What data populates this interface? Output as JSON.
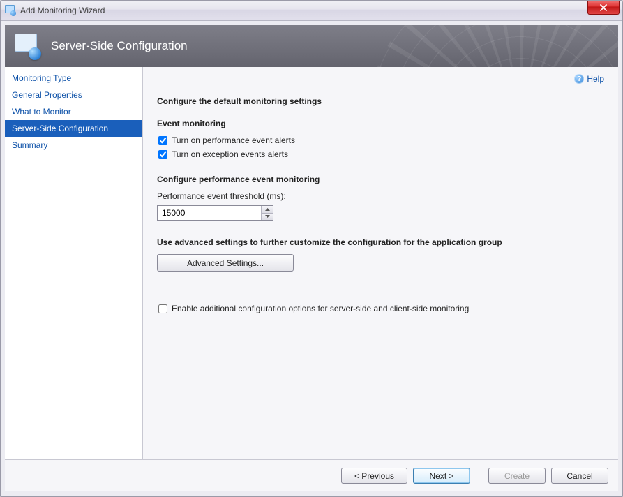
{
  "window": {
    "title": "Add Monitoring Wizard"
  },
  "banner": {
    "title": "Server-Side Configuration"
  },
  "sidebar": {
    "items": [
      {
        "label": "Monitoring Type",
        "selected": false
      },
      {
        "label": "General Properties",
        "selected": false
      },
      {
        "label": "What to Monitor",
        "selected": false
      },
      {
        "label": "Server-Side Configuration",
        "selected": true
      },
      {
        "label": "Summary",
        "selected": false
      }
    ]
  },
  "help": {
    "label": "Help"
  },
  "main": {
    "heading": "Configure the default monitoring settings",
    "event_monitoring": {
      "title": "Event monitoring",
      "perf_checkbox": "Turn on performance event alerts",
      "perf_checked": true,
      "exc_checkbox": "Turn on exception events alerts",
      "exc_checked": true
    },
    "perf_config": {
      "title": "Configure performance event monitoring",
      "threshold_label": "Performance event threshold (ms):",
      "threshold_value": "15000"
    },
    "advanced": {
      "title": "Use advanced settings to further customize the configuration for the application group",
      "button": "Advanced Settings..."
    },
    "enable_additional": {
      "label": "Enable additional configuration options for server-side and client-side monitoring",
      "checked": false
    }
  },
  "footer": {
    "previous": "< Previous",
    "next": "Next >",
    "create": "Create",
    "cancel": "Cancel"
  }
}
